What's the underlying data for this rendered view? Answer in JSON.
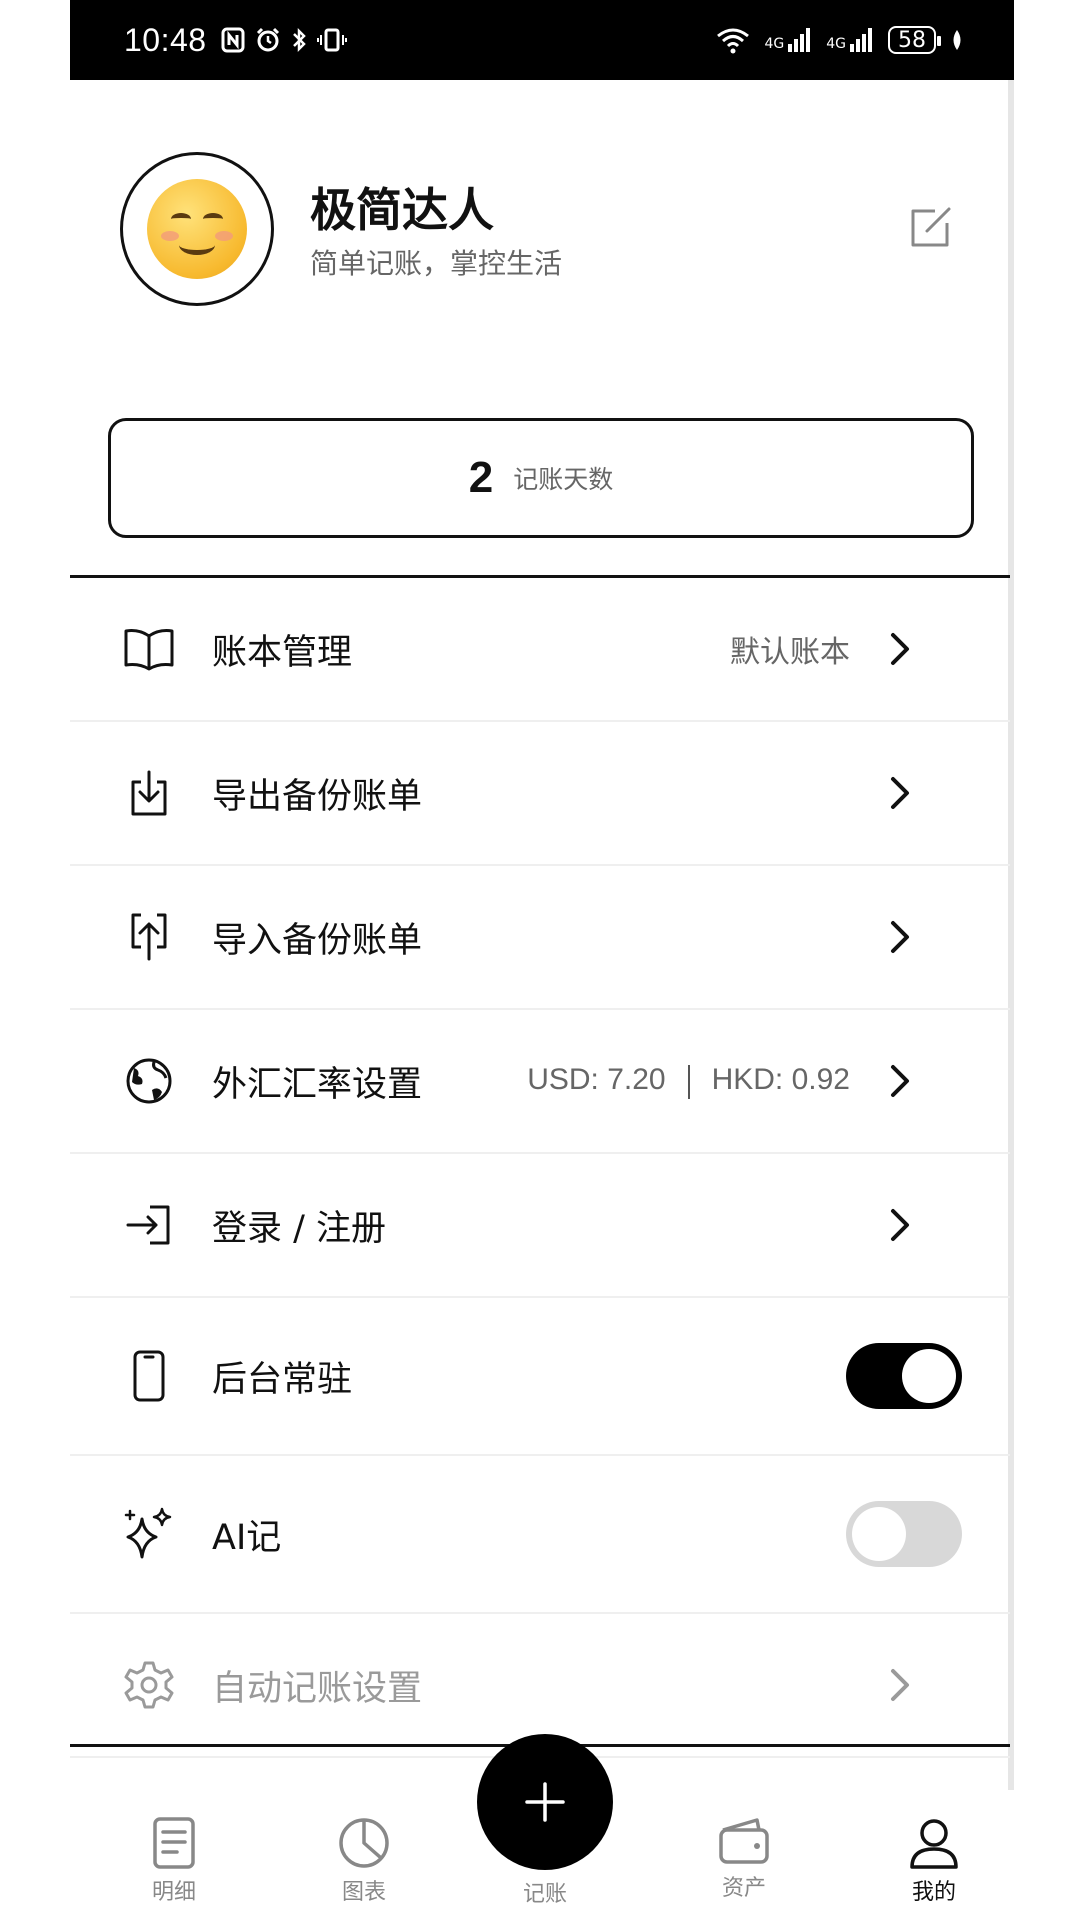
{
  "status": {
    "time": "10:48",
    "battery": "58",
    "network1": "4G",
    "network2": "4G"
  },
  "profile": {
    "name": "极简达人",
    "subtitle": "简单记账，掌控生活"
  },
  "stats": {
    "days_value": "2",
    "days_label": "记账天数"
  },
  "menu": [
    {
      "label": "账本管理",
      "value": "默认账本",
      "icon": "book-icon"
    },
    {
      "label": "导出备份账单",
      "icon": "download-icon"
    },
    {
      "label": "导入备份账单",
      "icon": "upload-icon"
    },
    {
      "label": "外汇汇率设置",
      "value_usd": "USD: 7.20",
      "value_hkd": "HKD: 0.92",
      "icon": "globe-icon"
    },
    {
      "label": "登录 / 注册",
      "icon": "login-icon"
    },
    {
      "label": "后台常驻",
      "toggle": true,
      "icon": "phone-icon"
    },
    {
      "label": "AI记",
      "toggle": false,
      "icon": "sparkle-icon"
    },
    {
      "label": "自动记账设置",
      "disabled": true,
      "icon": "gear-icon"
    }
  ],
  "tabs": [
    {
      "label": "明细",
      "icon": "detail-icon"
    },
    {
      "label": "图表",
      "icon": "chart-icon"
    },
    {
      "label": "记账",
      "icon": "plus-icon"
    },
    {
      "label": "资产",
      "icon": "wallet-icon"
    },
    {
      "label": "我的",
      "icon": "person-icon",
      "active": true
    }
  ],
  "colors": {
    "primary": "#000000",
    "muted": "#666666",
    "toggle_off": "#d8d8d8"
  }
}
